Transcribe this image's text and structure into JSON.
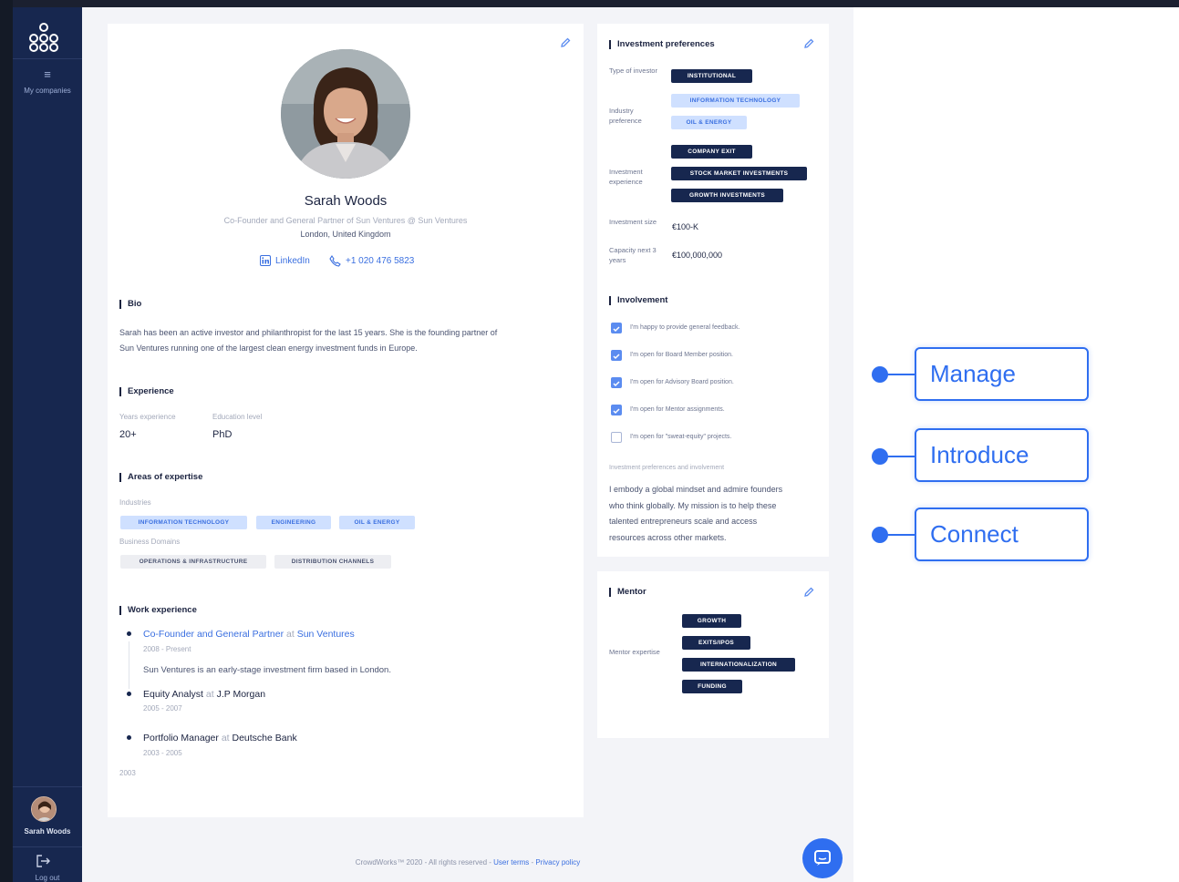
{
  "sidebar": {
    "menu_label": "My companies",
    "user_name": "Sarah Woods",
    "logout_label": "Log out"
  },
  "profile": {
    "name": "Sarah Woods",
    "role": "Co-Founder and General Partner of Sun Ventures @ Sun Ventures",
    "location": "London, United Kingdom",
    "linkedin_label": "LinkedIn",
    "phone": "+1 020 476 5823"
  },
  "bio": {
    "title": "Bio",
    "text_line1": "Sarah has been an active investor and philanthropist for the last 15 years. She is the founding partner of",
    "text_line2": "Sun Ventures running one of the largest clean energy investment funds in Europe."
  },
  "experience": {
    "title": "Experience",
    "years_label": "Years experience",
    "years_value": "20+",
    "education_label": "Education level",
    "education_value": "PhD"
  },
  "expertise": {
    "title": "Areas of expertise",
    "industries_label": "Industries",
    "industries": [
      "INFORMATION TECHNOLOGY",
      "ENGINEERING",
      "OIL & ENERGY"
    ],
    "domains_label": "Business Domains",
    "domains": [
      "OPERATIONS & INFRASTRUCTURE",
      "DISTRIBUTION CHANNELS"
    ]
  },
  "work": {
    "title": "Work experience",
    "items": [
      {
        "role": "Co-Founder and General Partner",
        "at": "at",
        "company": "Sun Ventures",
        "dates": "2008 - Present",
        "desc": "Sun Ventures is an early-stage investment firm based in London."
      },
      {
        "role": "Equity Analyst",
        "at": "at",
        "company": "J.P Morgan",
        "dates": "2005 - 2007"
      },
      {
        "role": "Portfolio Manager",
        "at": "at",
        "company": "Deutsche Bank",
        "dates": "2003 - 2005"
      }
    ],
    "start_year": "2003"
  },
  "investment": {
    "title": "Investment preferences",
    "type_label": "Type of investor",
    "type_value": "INSTITUTIONAL",
    "industry_label": "Industry preference",
    "industry_values": [
      "INFORMATION TECHNOLOGY",
      "OIL & ENERGY"
    ],
    "experience_label": "Investment experience",
    "experience_values": [
      "COMPANY EXIT",
      "STOCK MARKET INVESTMENTS",
      "GROWTH INVESTMENTS"
    ],
    "size_label": "Investment size",
    "size_value": "€100-K",
    "capacity_label": "Capacity next 3 years",
    "capacity_value": "€100,000,000"
  },
  "involvement": {
    "title": "Involvement",
    "items": [
      {
        "text": "I'm happy to provide general feedback.",
        "checked": true
      },
      {
        "text": "I'm open for Board Member position.",
        "checked": true
      },
      {
        "text": "I'm open for Advisory Board position.",
        "checked": true
      },
      {
        "text": "I'm open for Mentor assignments.",
        "checked": true
      },
      {
        "text": "I'm open for \"sweat-equity\" projects.",
        "checked": false
      }
    ],
    "prefs_label": "Investment preferences and involvement",
    "prefs_lines": [
      "I embody a global mindset and admire founders",
      "who think globally. My mission is to help these",
      "talented entrepreneurs scale and access",
      "resources across other markets."
    ]
  },
  "mentor": {
    "title": "Mentor",
    "label": "Mentor expertise",
    "tags": [
      "GROWTH",
      "EXITS/IPOS",
      "INTERNATIONALIZATION",
      "FUNDING"
    ]
  },
  "footer": {
    "copyright": "CrowdWorks™ 2020 - All rights reserved - ",
    "terms": "User terms",
    "sep": " - ",
    "privacy": "Privacy policy"
  },
  "annotations": [
    "Manage",
    "Introduce",
    "Connect"
  ],
  "colors": {
    "accent": "#2f6ef0",
    "sidebar": "#17274f",
    "chip_dark": "#17274f",
    "chip_light": "#cfe0ff"
  }
}
